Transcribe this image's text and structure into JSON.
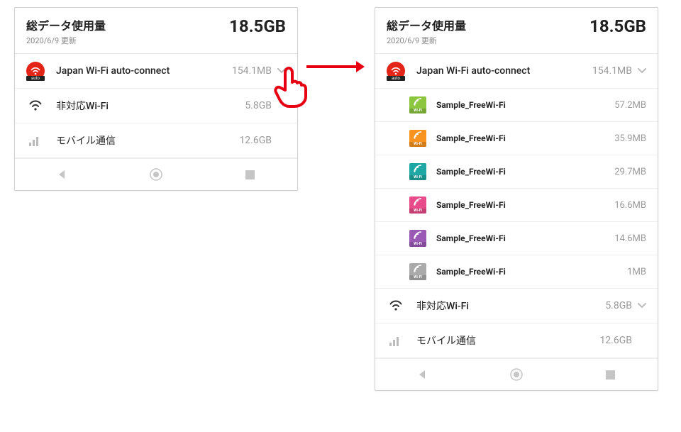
{
  "left": {
    "header": {
      "title": "総データ使用量",
      "date": "2020/6/9 更新",
      "usage": "18.5GB"
    },
    "rows": [
      {
        "label": "Japan Wi-Fi auto-connect",
        "value": "154.1MB",
        "expandable": true
      },
      {
        "label": "非対応Wi-Fi",
        "value": "5.8GB",
        "expandable": false
      },
      {
        "label": "モバイル通信",
        "value": "12.6GB",
        "expandable": false
      }
    ]
  },
  "right": {
    "header": {
      "title": "総データ使用量",
      "date": "2020/6/9 更新",
      "usage": "18.5GB"
    },
    "row_japan": {
      "label": "Japan Wi-Fi auto-connect",
      "value": "154.1MB"
    },
    "sub": [
      {
        "label": "Sample_FreeWi-Fi",
        "value": "57.2MB",
        "color": "#8cc63f"
      },
      {
        "label": "Sample_FreeWi-Fi",
        "value": "35.9MB",
        "color": "#f7931e"
      },
      {
        "label": "Sample_FreeWi-Fi",
        "value": "29.7MB",
        "color": "#1fa8a3"
      },
      {
        "label": "Sample_FreeWi-Fi",
        "value": "16.6MB",
        "color": "#e84b8a"
      },
      {
        "label": "Sample_FreeWi-Fi",
        "value": "14.6MB",
        "color": "#9b59b6"
      },
      {
        "label": "Sample_FreeWi-Fi",
        "value": "1MB",
        "color": "#aaaaaa"
      }
    ],
    "row_nonwifi": {
      "label": "非対応Wi-Fi",
      "value": "5.8GB"
    },
    "row_mobile": {
      "label": "モバイル通信",
      "value": "12.6GB"
    }
  },
  "icons": {
    "auto": "auto",
    "wifi": "Wi-Fi"
  }
}
